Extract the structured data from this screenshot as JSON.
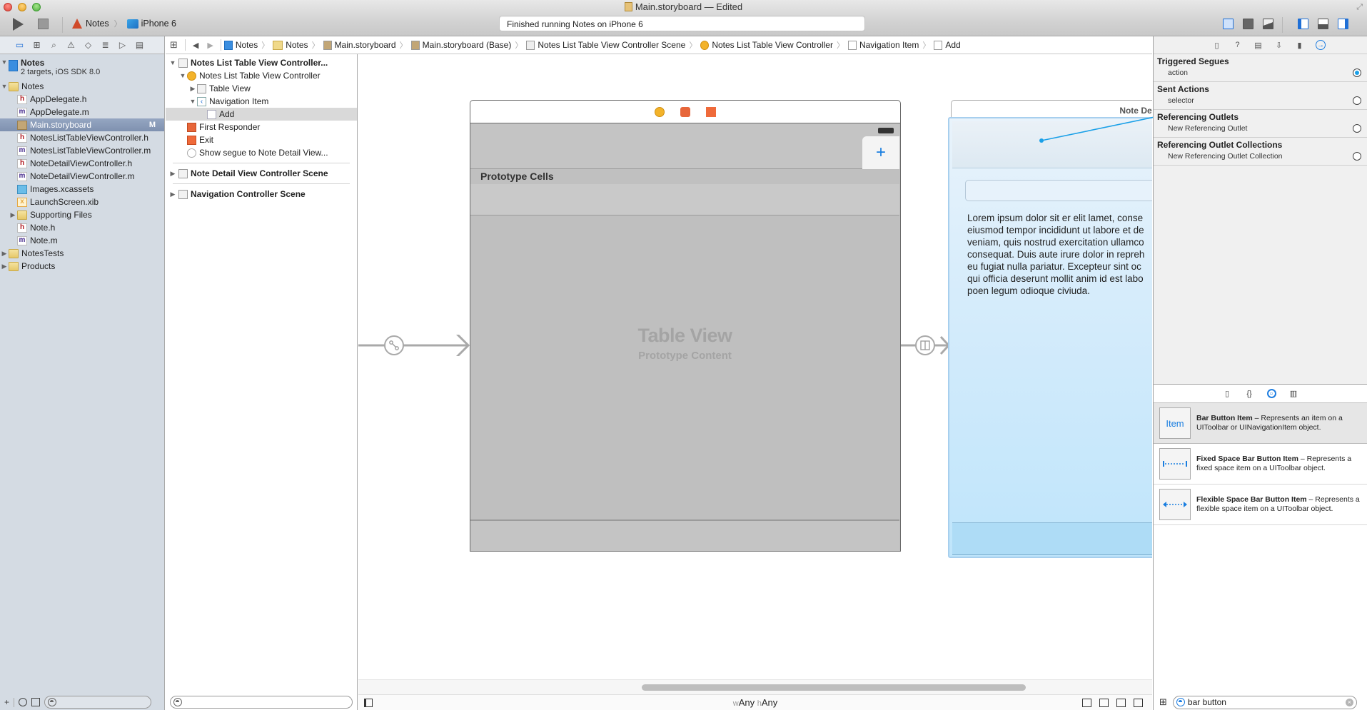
{
  "window": {
    "title": "Main.storyboard — Edited",
    "status": "Finished running Notes on iPhone 6"
  },
  "toolbar": {
    "scheme": "Notes",
    "device": "iPhone 6",
    "run_icon": "play-icon",
    "stop_icon": "stop-icon",
    "editor_modes": [
      "standard-editor-icon",
      "assistant-editor-icon",
      "version-editor-icon"
    ],
    "view_toggles": [
      "navigator-toggle-icon",
      "debug-area-toggle-icon",
      "utilities-toggle-icon"
    ]
  },
  "navigator": {
    "tabs": [
      "project",
      "symbol",
      "find",
      "issue",
      "test",
      "debug",
      "breakpoint",
      "report"
    ],
    "tab_glyphs": [
      "▭",
      "⊞",
      "⌕",
      "⚠",
      "◇",
      "≣",
      "▷",
      "▤"
    ],
    "project": {
      "name": "Notes",
      "subtitle": "2 targets, iOS SDK 8.0"
    },
    "items": [
      {
        "label": "Notes",
        "type": "folder",
        "indent": 1,
        "disclosure": "▼"
      },
      {
        "label": "AppDelegate.h",
        "type": "h",
        "indent": 2
      },
      {
        "label": "AppDelegate.m",
        "type": "m",
        "indent": 2
      },
      {
        "label": "Main.storyboard",
        "type": "story",
        "indent": 2,
        "selected": true,
        "badge": "M"
      },
      {
        "label": "NotesListTableViewController.h",
        "type": "h",
        "indent": 2
      },
      {
        "label": "NotesListTableViewController.m",
        "type": "m",
        "indent": 2
      },
      {
        "label": "NoteDetailViewController.h",
        "type": "h",
        "indent": 2
      },
      {
        "label": "NoteDetailViewController.m",
        "type": "m",
        "indent": 2
      },
      {
        "label": "Images.xcassets",
        "type": "xc",
        "indent": 2
      },
      {
        "label": "LaunchScreen.xib",
        "type": "xib",
        "indent": 2
      },
      {
        "label": "Supporting Files",
        "type": "folder",
        "indent": 2,
        "disclosure": "▶"
      },
      {
        "label": "Note.h",
        "type": "h",
        "indent": 2
      },
      {
        "label": "Note.m",
        "type": "m",
        "indent": 2
      },
      {
        "label": "NotesTests",
        "type": "folder",
        "indent": 1,
        "disclosure": "▶"
      },
      {
        "label": "Products",
        "type": "folder",
        "indent": 1,
        "disclosure": "▶"
      }
    ],
    "filter_placeholder": ""
  },
  "jumpbar": {
    "crumbs": [
      "Notes",
      "Notes",
      "Main.storyboard",
      "Main.storyboard (Base)",
      "Notes List Table View Controller Scene",
      "Notes List Table View Controller",
      "Navigation Item",
      "Add"
    ]
  },
  "outline": {
    "scene1_title": "Notes List Table View Controller...",
    "items": [
      {
        "label": "Notes List Table View Controller",
        "icon": "vc",
        "indent": 1,
        "disclosure": "▼"
      },
      {
        "label": "Table View",
        "icon": "table",
        "indent": 2,
        "disclosure": "▶"
      },
      {
        "label": "Navigation Item",
        "icon": "navi",
        "indent": 2,
        "disclosure": "▼"
      },
      {
        "label": "Add",
        "icon": "item",
        "indent": 3,
        "selected": true
      },
      {
        "label": "First Responder",
        "icon": "fr",
        "indent": 1
      },
      {
        "label": "Exit",
        "icon": "exit",
        "indent": 1
      },
      {
        "label": "Show segue to Note Detail View...",
        "icon": "segue",
        "indent": 1
      }
    ],
    "scenes": [
      "Note Detail View Controller Scene",
      "Navigation Controller Scene"
    ]
  },
  "canvas": {
    "scene1": {
      "section_header": "Prototype Cells",
      "placeholder_title": "Table View",
      "placeholder_subtitle": "Prototype Content",
      "add_button": "+"
    },
    "scene2": {
      "title": "Note Detail",
      "body_lines": [
        "Lorem ipsum dolor sit er elit lamet, conse",
        "eiusmod tempor incididunt ut labore et de",
        "veniam, quis nostrud exercitation ullamco",
        "consequat. Duis aute irure dolor in repreh",
        "eu fugiat nulla pariatur. Excepteur sint oc",
        "qui officia deserunt mollit anim id est labo",
        "poen legum odioque civiuda."
      ]
    },
    "size_class": {
      "w_prefix": "w",
      "w_value": "Any",
      "h_prefix": "h",
      "h_value": "Any"
    }
  },
  "inspector": {
    "sections": [
      {
        "title": "Triggered Segues",
        "rows": [
          {
            "label": "action",
            "connected": true
          }
        ]
      },
      {
        "title": "Sent Actions",
        "rows": [
          {
            "label": "selector",
            "connected": false
          }
        ]
      },
      {
        "title": "Referencing Outlets",
        "rows": [
          {
            "label": "New Referencing Outlet",
            "connected": false
          }
        ]
      },
      {
        "title": "Referencing Outlet Collections",
        "rows": [
          {
            "label": "New Referencing Outlet Collection",
            "connected": false
          }
        ]
      }
    ]
  },
  "library": {
    "items": [
      {
        "thumb": "Item",
        "name": "Bar Button Item",
        "desc": " – Represents an item on a UIToolbar or UINavigationItem object.",
        "selected": true
      },
      {
        "thumb": "fixed-space",
        "name": "Fixed Space Bar Button Item",
        "desc": " – Represents a fixed space item on a UIToolbar object."
      },
      {
        "thumb": "flexible-space",
        "name": "Flexible Space Bar Button Item",
        "desc": " – Represents a flexible space item on a UIToolbar object."
      }
    ],
    "search_value": "bar button"
  },
  "colors": {
    "accent": "#1f7ee0",
    "connection_line": "#1aa0e8",
    "selection": "#7f91b0"
  }
}
